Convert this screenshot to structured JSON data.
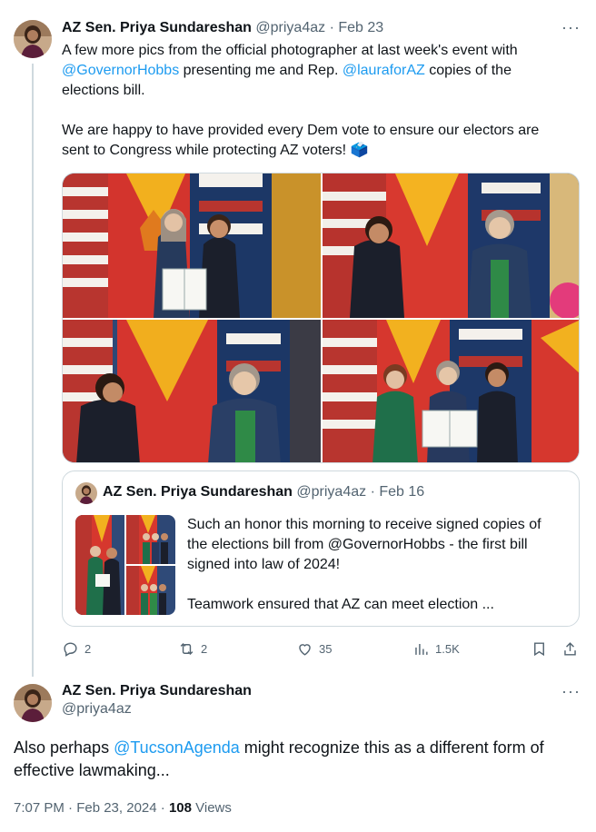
{
  "tweet1": {
    "author_name": "AZ Sen. Priya Sundareshan",
    "handle": "@priya4az",
    "date": "Feb 23",
    "more_icon": "more-dots-icon",
    "text": {
      "line1": "A few more pics from the official photographer at last week's event with",
      "mention_governor": "@GovernorHobbs",
      "line2_rest": " presenting me and Rep. ",
      "mention_laura": "@lauraforAZ",
      "line2_end": " copies of the",
      "line3": "elections bill.",
      "para2_line1": "We are happy to have provided every Dem vote to ensure our electors are",
      "para2_line2": "sent to Congress while protecting AZ voters! ",
      "emoji": "🗳️"
    },
    "photos": [
      "photo-1",
      "photo-2",
      "photo-3",
      "photo-4"
    ],
    "quote": {
      "author_name": "AZ Sen. Priya Sundareshan",
      "handle": "@priya4az",
      "date": "Feb 16",
      "line1": "Such an honor this morning to receive signed copies of",
      "line2": "the elections bill from @GovernorHobbs - the first bill",
      "line3": "signed into law of 2024!",
      "line4": "Teamwork ensured that AZ can meet election ..."
    },
    "actions": {
      "replies": "2",
      "reposts": "2",
      "likes": "35",
      "views": "1.5K"
    }
  },
  "tweet2": {
    "author_name": "AZ Sen. Priya Sundareshan",
    "handle": "@priya4az",
    "text_prefix": "Also perhaps ",
    "mention": "@TucsonAgenda",
    "text_rest": " might recognize this as a different form of",
    "text_line2": "effective lawmaking...",
    "timestamp": "7:07 PM · Feb 23, 2024",
    "dot": " · ",
    "views_count": "108",
    "views_label": " Views"
  },
  "colors": {
    "link": "#1d9bf0",
    "muted": "#536471",
    "border": "#cfd9de",
    "text": "#0f1419"
  }
}
